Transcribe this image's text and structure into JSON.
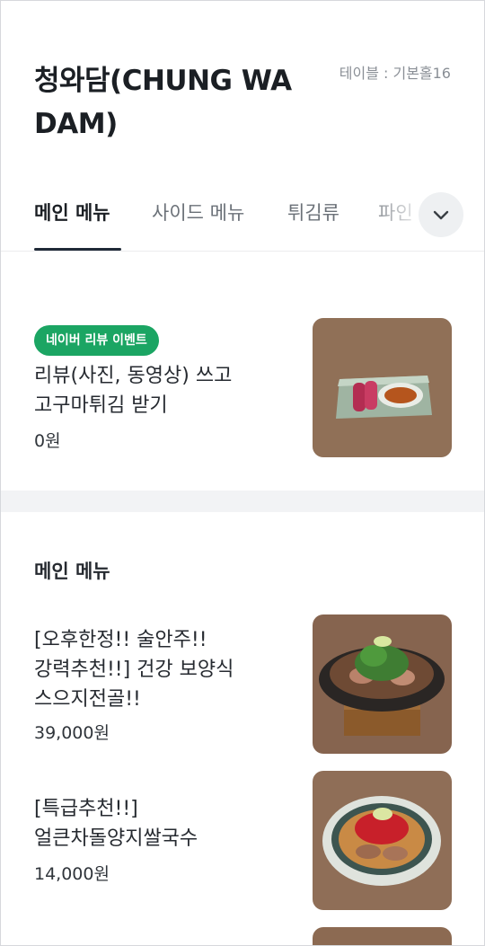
{
  "header": {
    "store_name": "청와담(CHUNG WA DAM)",
    "table_label": "테이블 : 기본홀16"
  },
  "tabs": [
    {
      "label": "메인 메뉴",
      "active": true
    },
    {
      "label": "사이드 메뉴",
      "active": false
    },
    {
      "label": "튀김류",
      "active": false
    },
    {
      "label": "파인",
      "active": false
    }
  ],
  "event_item": {
    "badge": "네이버 리뷰 이벤트",
    "name_line1": "리뷰(사진, 동영상) 쓰고",
    "name_line2": "고구마튀김 받기",
    "price": "0원"
  },
  "section": {
    "title": "메인 메뉴"
  },
  "menu_items": [
    {
      "name_line1": "[오후한정!! 술안주!!",
      "name_line2": "강력추천!!] 건강 보양식",
      "name_line3": "스으지전골!!",
      "price": "39,000원"
    },
    {
      "name_line1": "[특급추천!!]",
      "name_line2": "얼큰차돌양지쌀국수",
      "price": "14,000원"
    }
  ],
  "colors": {
    "badge_green": "#1ba563",
    "tab_underline": "#1f2937",
    "muted_text": "#8a8f96"
  }
}
